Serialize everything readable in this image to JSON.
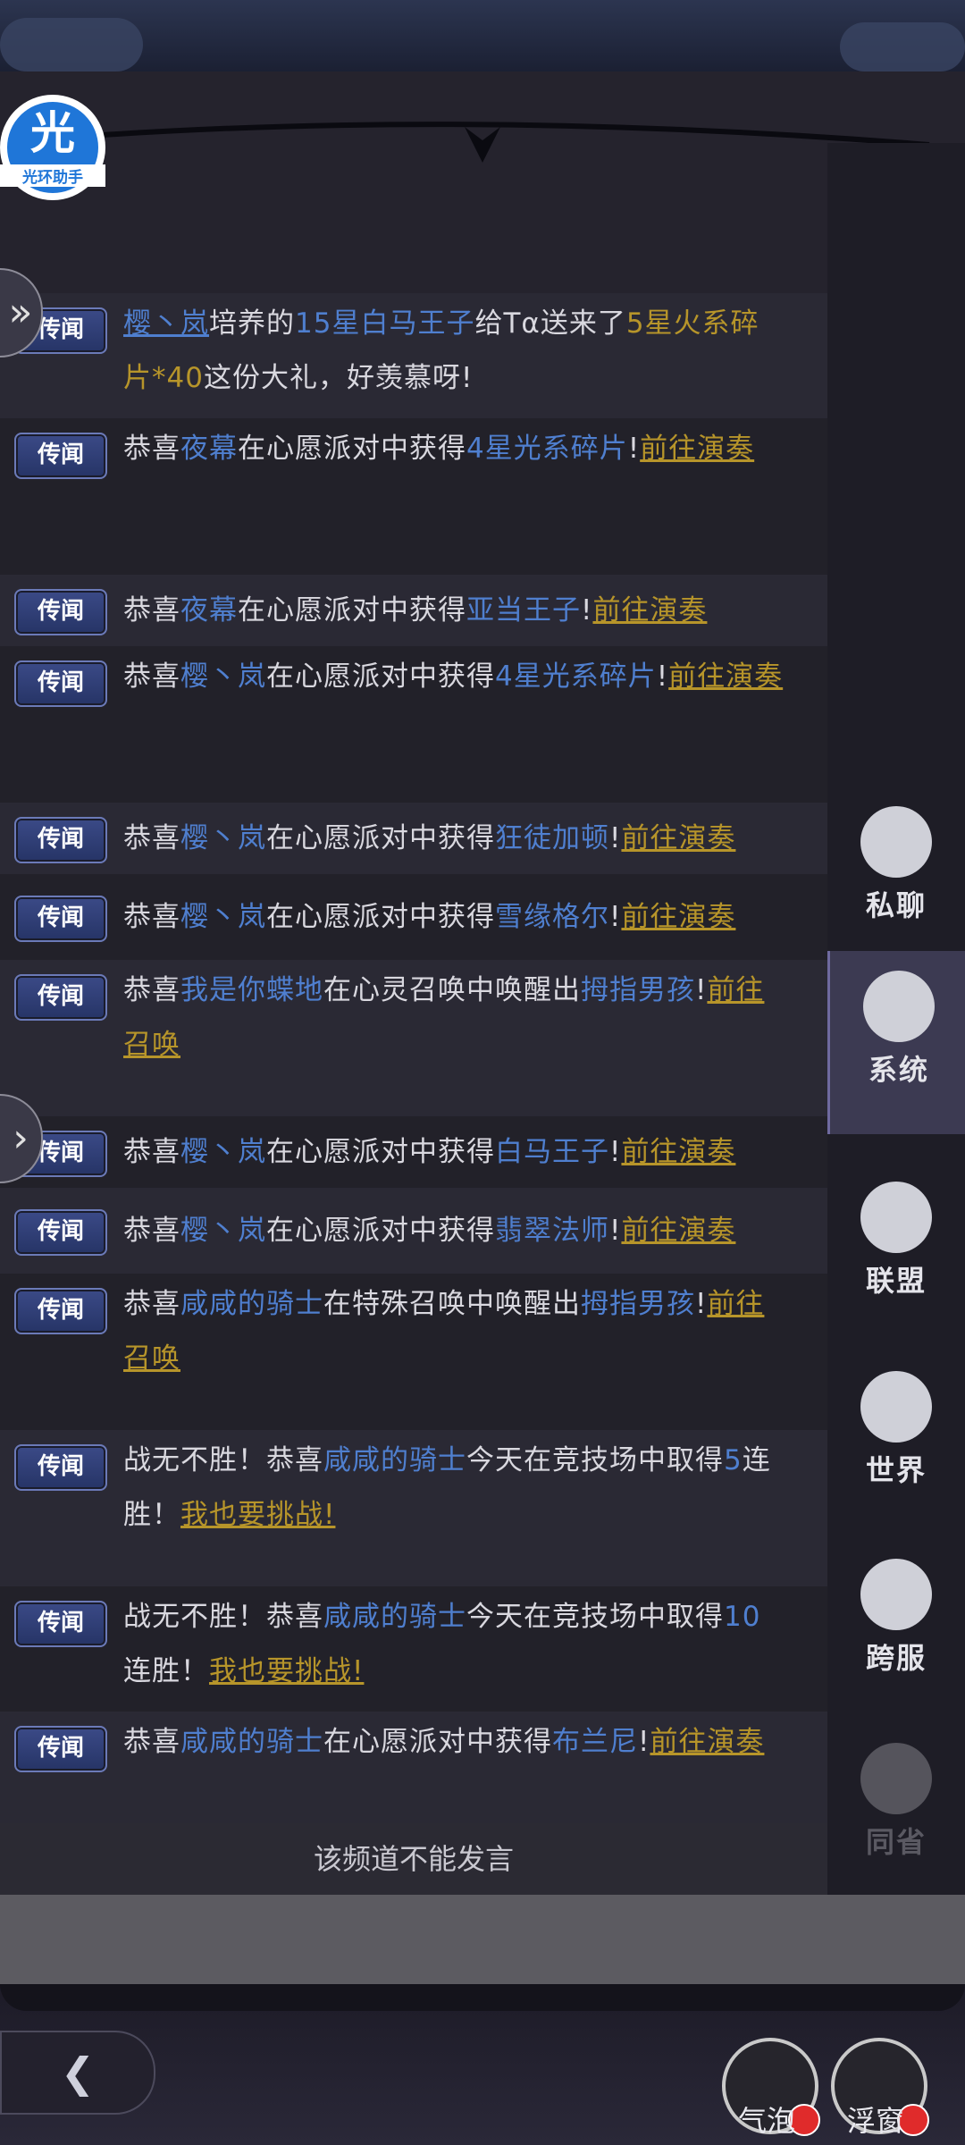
{
  "assistant": {
    "big": "光",
    "label": "光环助手"
  },
  "messages": [
    {
      "tag": "传闻",
      "segments": [
        {
          "t": "樱丶岚",
          "c": "n ul"
        },
        {
          "t": "培养的",
          "c": ""
        },
        {
          "t": "15星白马王子",
          "c": "n"
        },
        {
          "t": "给Tα送来了",
          "c": ""
        },
        {
          "t": "5星火系碎片*40",
          "c": "g"
        },
        {
          "t": "这份大礼，好羡慕呀!",
          "c": ""
        }
      ]
    },
    {
      "tag": "传闻",
      "segments": [
        {
          "t": "恭喜",
          "c": ""
        },
        {
          "t": "夜幕",
          "c": "n"
        },
        {
          "t": "在心愿派对中获得",
          "c": ""
        },
        {
          "t": "4星光系碎片",
          "c": "n"
        },
        {
          "t": "!",
          "c": ""
        },
        {
          "t": "前往演奏",
          "c": "lk"
        }
      ]
    },
    {
      "tag": "传闻",
      "segments": [
        {
          "t": "恭喜",
          "c": ""
        },
        {
          "t": "夜幕",
          "c": "n"
        },
        {
          "t": "在心愿派对中获得",
          "c": ""
        },
        {
          "t": "亚当王子",
          "c": "n"
        },
        {
          "t": "!",
          "c": ""
        },
        {
          "t": "前往演奏",
          "c": "lk"
        }
      ]
    },
    {
      "tag": "传闻",
      "segments": [
        {
          "t": "恭喜",
          "c": ""
        },
        {
          "t": "樱丶岚",
          "c": "n"
        },
        {
          "t": "在心愿派对中获得",
          "c": ""
        },
        {
          "t": "4星光系碎片",
          "c": "n"
        },
        {
          "t": "!",
          "c": ""
        },
        {
          "t": "前往演奏",
          "c": "lk"
        }
      ]
    },
    {
      "tag": "传闻",
      "segments": [
        {
          "t": "恭喜",
          "c": ""
        },
        {
          "t": "樱丶岚",
          "c": "n"
        },
        {
          "t": "在心愿派对中获得",
          "c": ""
        },
        {
          "t": "狂徒加顿",
          "c": "n"
        },
        {
          "t": "!",
          "c": ""
        },
        {
          "t": "前往演奏",
          "c": "lk"
        }
      ]
    },
    {
      "tag": "传闻",
      "segments": [
        {
          "t": "恭喜",
          "c": ""
        },
        {
          "t": "樱丶岚",
          "c": "n"
        },
        {
          "t": "在心愿派对中获得",
          "c": ""
        },
        {
          "t": "雪缘格尔",
          "c": "n"
        },
        {
          "t": "!",
          "c": ""
        },
        {
          "t": "前往演奏",
          "c": "lk"
        }
      ]
    },
    {
      "tag": "传闻",
      "segments": [
        {
          "t": "恭喜",
          "c": ""
        },
        {
          "t": "我是你蝶地",
          "c": "n"
        },
        {
          "t": "在心灵召唤中唤醒出",
          "c": ""
        },
        {
          "t": "拇指男孩",
          "c": "n"
        },
        {
          "t": "!",
          "c": ""
        },
        {
          "t": "前往召唤",
          "c": "lk"
        }
      ]
    },
    {
      "tag": "传闻",
      "segments": [
        {
          "t": "恭喜",
          "c": ""
        },
        {
          "t": "樱丶岚",
          "c": "n"
        },
        {
          "t": "在心愿派对中获得",
          "c": ""
        },
        {
          "t": "白马王子",
          "c": "n"
        },
        {
          "t": "!",
          "c": ""
        },
        {
          "t": "前往演奏",
          "c": "lk"
        }
      ]
    },
    {
      "tag": "传闻",
      "segments": [
        {
          "t": "恭喜",
          "c": ""
        },
        {
          "t": "樱丶岚",
          "c": "n"
        },
        {
          "t": "在心愿派对中获得",
          "c": ""
        },
        {
          "t": "翡翠法师",
          "c": "n"
        },
        {
          "t": "!",
          "c": ""
        },
        {
          "t": "前往演奏",
          "c": "lk"
        }
      ]
    },
    {
      "tag": "传闻",
      "segments": [
        {
          "t": "恭喜",
          "c": ""
        },
        {
          "t": "咸咸的骑士",
          "c": "n"
        },
        {
          "t": "在特殊召唤中唤醒出",
          "c": ""
        },
        {
          "t": "拇指男孩",
          "c": "n"
        },
        {
          "t": "!",
          "c": ""
        },
        {
          "t": "前往召唤",
          "c": "lk"
        }
      ]
    },
    {
      "tag": "传闻",
      "segments": [
        {
          "t": "战无不胜！恭喜",
          "c": ""
        },
        {
          "t": "咸咸的骑士",
          "c": "n"
        },
        {
          "t": "今天在竞技场中取得",
          "c": ""
        },
        {
          "t": "5",
          "c": "n"
        },
        {
          "t": "连胜！",
          "c": ""
        },
        {
          "t": "我也要挑战!",
          "c": "lk"
        }
      ]
    },
    {
      "tag": "传闻",
      "segments": [
        {
          "t": "战无不胜！恭喜",
          "c": ""
        },
        {
          "t": "咸咸的骑士",
          "c": "n"
        },
        {
          "t": "今天在竞技场中取得",
          "c": ""
        },
        {
          "t": "10",
          "c": "n"
        },
        {
          "t": "连胜！",
          "c": ""
        },
        {
          "t": "我也要挑战!",
          "c": "lk"
        }
      ]
    },
    {
      "tag": "传闻",
      "segments": [
        {
          "t": "恭喜",
          "c": ""
        },
        {
          "t": "咸咸的骑士",
          "c": "n"
        },
        {
          "t": "在心愿派对中获得",
          "c": ""
        },
        {
          "t": "布兰尼",
          "c": "n"
        },
        {
          "t": "!",
          "c": ""
        },
        {
          "t": "前往演奏",
          "c": "lk"
        }
      ]
    }
  ],
  "cannot_speak": "该频道不能发言",
  "sidebar": [
    {
      "label": "私聊",
      "icon": "ghost-chat-icon",
      "state": "normal"
    },
    {
      "label": "系统",
      "icon": "megaphone-icon",
      "state": "active"
    },
    {
      "label": "联盟",
      "icon": "banner-icon",
      "state": "normal"
    },
    {
      "label": "世界",
      "icon": "compass-icon",
      "state": "normal"
    },
    {
      "label": "跨服",
      "icon": "planet-icon",
      "state": "normal"
    },
    {
      "label": "同省",
      "icon": "location-pin-icon",
      "state": "disabled"
    }
  ],
  "bottom": {
    "bubble_label": "气泡",
    "float_label": "浮窗"
  },
  "colors": {
    "name_blue": "#4f7fcf",
    "link_gold": "#b7952a",
    "tag_blue": "#3b4a87"
  }
}
